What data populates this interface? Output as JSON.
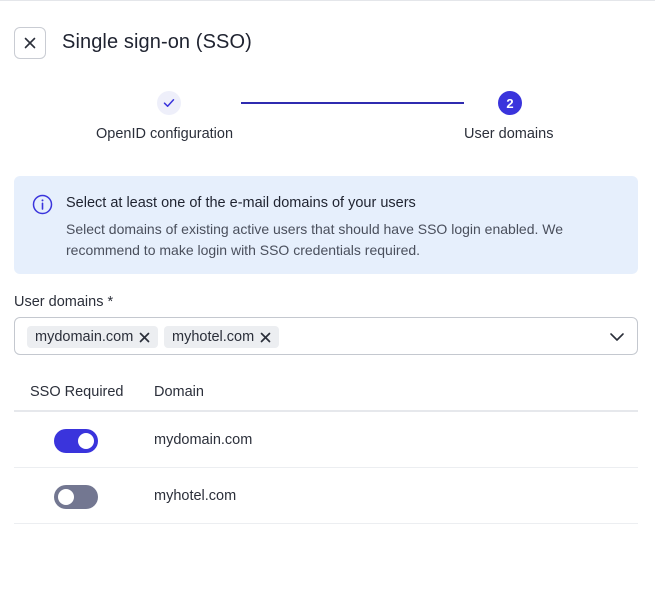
{
  "dialog": {
    "title": "Single sign-on (SSO)"
  },
  "stepper": {
    "steps": [
      {
        "label": "OpenID configuration",
        "state": "completed"
      },
      {
        "label": "User domains",
        "number": "2",
        "state": "active"
      }
    ]
  },
  "info": {
    "title": "Select at least one of the e-mail domains of your users",
    "text": "Select domains of existing active users that should have SSO login enabled. We recommend to make login with SSO credentials required."
  },
  "domains_field": {
    "label": "User domains *",
    "selected": [
      "mydomain.com",
      "myhotel.com"
    ]
  },
  "table": {
    "columns": [
      "SSO Required",
      "Domain"
    ],
    "rows": [
      {
        "domain": "mydomain.com",
        "sso_required": true
      },
      {
        "domain": "myhotel.com",
        "sso_required": false
      }
    ]
  },
  "colors": {
    "accent": "#3a34dc",
    "info_bg": "#e6effc",
    "toggle_off": "#737791"
  }
}
